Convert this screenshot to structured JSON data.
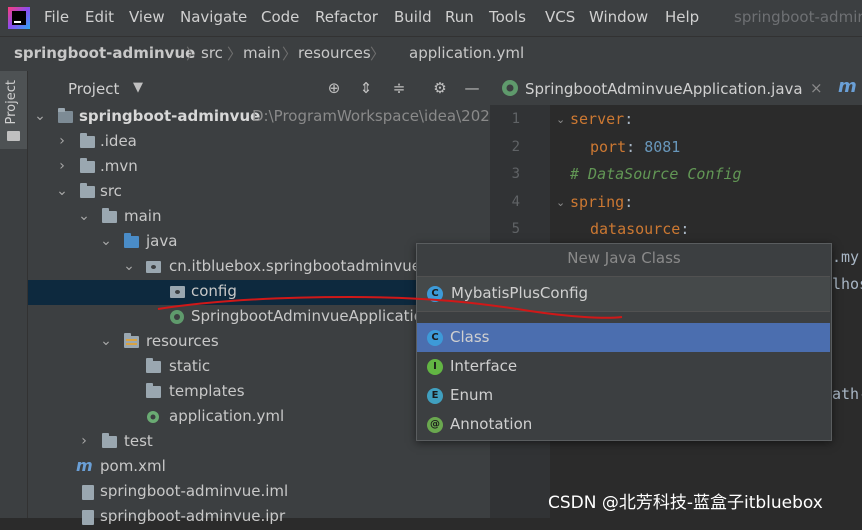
{
  "menubar": {
    "items": [
      "File",
      "Edit",
      "View",
      "Navigate",
      "Code",
      "Refactor",
      "Build",
      "Run",
      "Tools",
      "VCS",
      "Window",
      "Help"
    ],
    "window_title": "springboot-admin"
  },
  "breadcrumb": {
    "items": [
      "springboot-adminvue",
      "src",
      "main",
      "resources",
      "application.yml"
    ]
  },
  "side_strip": {
    "label": "Project"
  },
  "project_panel": {
    "title": "Project",
    "tree": [
      {
        "label": "springboot-adminvue",
        "suffix": "D:\\ProgramWorkspace\\idea\\202"
      },
      {
        "label": ".idea"
      },
      {
        "label": ".mvn"
      },
      {
        "label": "src"
      },
      {
        "label": "main"
      },
      {
        "label": "java"
      },
      {
        "label": "cn.itbluebox.springbootadminvue"
      },
      {
        "label": "config"
      },
      {
        "label": "SpringbootAdminvueApplicatio"
      },
      {
        "label": "resources"
      },
      {
        "label": "static"
      },
      {
        "label": "templates"
      },
      {
        "label": "application.yml"
      },
      {
        "label": "test"
      },
      {
        "label": "pom.xml"
      },
      {
        "label": "springboot-adminvue.iml"
      },
      {
        "label": "springboot-adminvue.ipr"
      }
    ]
  },
  "editor": {
    "tab": "SpringbootAdminvueApplication.java",
    "tab_close": "×",
    "line_numbers": [
      "1",
      "2",
      "3",
      "4",
      "5"
    ],
    "lines": [
      {
        "key": "server",
        "punct": ":"
      },
      {
        "key": "port",
        "punct": ":",
        "value": "8081"
      },
      {
        "comment": "# DataSource Config"
      },
      {
        "key": "spring",
        "punct": ":"
      },
      {
        "key": "datasource",
        "punct": ":"
      }
    ],
    "peek": [
      ".my",
      "lhos",
      "ath-"
    ]
  },
  "popup": {
    "title": "New Java Class",
    "input_value": "MybatisPlusConfig",
    "options": [
      "Class",
      "Interface",
      "Enum",
      "Annotation"
    ],
    "selected": "Class"
  },
  "watermark": "CSDN @北芳科技-蓝盒子itbluebox",
  "colors": {
    "accent": "#4b6eaf",
    "selection": "#0d293e",
    "annotation": "#d01818"
  }
}
